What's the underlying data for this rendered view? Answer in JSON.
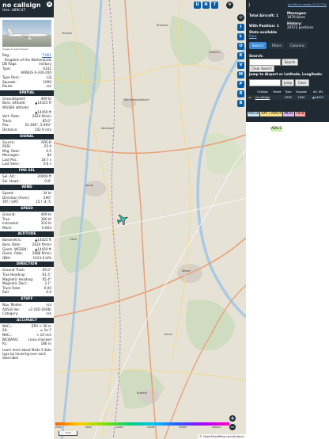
{
  "aircraft": {
    "callsign": "no callsign",
    "hex": "Hex: 489C47",
    "photo_credit": "Image © Gerrit Griem",
    "reg_label": "Reg.:",
    "reg_value": "T-061",
    "country": "Kingdom of the Netherlands",
    "db_flags_label": "DB flags:",
    "db_flags_value": "military",
    "type_label": "Type:",
    "type_value": "A332",
    "type_name": "AIRBUS A-330-200",
    "type_desc_label": "Type Desc.:",
    "type_desc_value": "L2J",
    "squawk_label": "Squawk:",
    "squawk_value": "1000",
    "route_label": "Route:",
    "route_value": "n/a"
  },
  "sections": {
    "spatial": {
      "title": "SPATIAL",
      "rows": [
        {
          "k": "Groundspeed:",
          "v": "409 kt"
        },
        {
          "k": "Baro. altitude:",
          "v": "▲14425 ft"
        },
        {
          "k": "WGS84 altitude:",
          "v": ""
        },
        {
          "k": "",
          "v": "▲14450 ft"
        },
        {
          "k": "Vert. Rate:",
          "v": "2624 ft/min"
        },
        {
          "k": "Track:",
          "v": "65.0°"
        },
        {
          "k": "Pos.:",
          "v": "51.466°, 5.993°"
        },
        {
          "k": "Distance:",
          "v": "102.9 nmi"
        }
      ]
    },
    "signal": {
      "title": "SIGNAL",
      "rows": [
        {
          "k": "Source:",
          "v": "ADS-B"
        },
        {
          "k": "RSSI:",
          "v": "-25.9"
        },
        {
          "k": "Msg. Rate:",
          "v": "0.5"
        },
        {
          "k": "Messages:",
          "v": "84"
        },
        {
          "k": "Last Pos.:",
          "v": "18.7 s"
        },
        {
          "k": "Last Seen:",
          "v": "0.6 s"
        }
      ]
    },
    "fms": {
      "title": "FMS SEL",
      "rows": [
        {
          "k": "Sel. Alt.:",
          "v": "20000 ft"
        },
        {
          "k": "Sel. Head.:",
          "v": "0.8°"
        }
      ]
    },
    "wind": {
      "title": "WIND",
      "rows": [
        {
          "k": "Speed:",
          "v": "34 kt"
        },
        {
          "k": "Direction (from):",
          "v": "290°"
        },
        {
          "k": "TAT / OAT:",
          "v": "15 / -4 °C"
        }
      ]
    },
    "speed": {
      "title": "SPEED",
      "rows": [
        {
          "k": "Ground:",
          "v": "409 kt"
        },
        {
          "k": "True:",
          "v": "386 kt"
        },
        {
          "k": "Indicated:",
          "v": "310 kt"
        },
        {
          "k": "Mach:",
          "v": "0.604"
        }
      ]
    },
    "altitude": {
      "title": "ALTITUDE",
      "rows": [
        {
          "k": "Barometric:",
          "v": "▲14425 ft"
        },
        {
          "k": "Baro. Rate:",
          "v": "2624 ft/min"
        },
        {
          "k": "Geom. WGS84:",
          "v": "▲14450 ft"
        },
        {
          "k": "Geom. Rate:",
          "v": "2688 ft/min"
        },
        {
          "k": "QNH:",
          "v": "1013.6 hPa"
        }
      ]
    },
    "direction": {
      "title": "DIRECTION",
      "rows": [
        {
          "k": "Ground Track:",
          "v": "65.0°"
        },
        {
          "k": "True Heading:",
          "v": "61.5°"
        },
        {
          "k": "Magnetic Heading:",
          "v": "65.4°"
        },
        {
          "k": "Magnetic Decl.:",
          "v": "3.1°"
        },
        {
          "k": "Track Rate:",
          "v": "0.00"
        },
        {
          "k": "Roll:",
          "v": "0.0"
        }
      ]
    },
    "stuff": {
      "title": "STUFF",
      "rows": [
        {
          "k": "Nav. Modes:",
          "v": "n/a"
        },
        {
          "k": "ADS-B Ver.:",
          "v": "v2 (DO-260B)"
        },
        {
          "k": "Category:",
          "v": "n/a"
        }
      ]
    },
    "accuracy": {
      "title": "ACCURACY",
      "rows": [
        {
          "k": "NACₚ:",
          "v": "EPU < 30 m"
        },
        {
          "k": "SIL:",
          "v": "≤ 1e-7"
        },
        {
          "k": "NACᵥ:",
          "v": "< 10 m/s"
        },
        {
          "k": "NICBARO:",
          "v": "cross-checked"
        },
        {
          "k": "Rc:",
          "v": "186 m"
        }
      ]
    },
    "footer": "Learn more about Mode S data type by hovering over each data label"
  },
  "map": {
    "top_buttons": [
      "U",
      "H",
      "T"
    ],
    "vertical_buttons": [
      "I",
      "L",
      "O",
      "K",
      "V",
      "M",
      "P",
      "R",
      "B"
    ],
    "zoom_in": "+",
    "zoom_out": "−",
    "scale": "1 km",
    "altitude_ticks": [
      "2000",
      "6000",
      "10000",
      "20000",
      "30000",
      "40000+"
    ],
    "attribution": "© OpenStreetMap contributors.",
    "places": [
      "Venlo",
      "Wesel",
      "Krefeld",
      "Geldern",
      "Mönchengladbach",
      "Goch",
      "Kleve",
      "Kevelaer",
      "Straelen",
      "Viersen"
    ]
  },
  "sidebar": {
    "collapse": "⟩",
    "header_link": "tar1090 on readsb (3.14.1770)",
    "total_aircraft_label": "Total Aircraft:",
    "total_aircraft_value": "1",
    "with_position_label": "With Position:",
    "with_position_value": "1",
    "messages_label": "Messages:",
    "messages_value": "1879.8/sec",
    "history_label": "History:",
    "history_value": "20572 positions",
    "stats_label": "Stats available",
    "stats_link": "here",
    "tabs": [
      "Search",
      "Filters",
      "Columns"
    ],
    "search_label": "Search:",
    "search_button": "Search",
    "clear_search_button": "Clear Search",
    "jump_label": "Jump to Airport or Latitude, Longitude:",
    "jump_button": "Jump",
    "clear_button": "Clear",
    "columns": [
      "",
      "Callsign",
      "Route",
      "Type",
      "Squawk",
      "Alt. (ft)"
    ],
    "rows": [
      {
        "flag": "▬",
        "callsign": "no callsign",
        "route": "",
        "type": "A332",
        "squawk": "1000",
        "alt": "▲14425"
      }
    ],
    "legend": [
      "ADS-B",
      "UAT / ADS-R",
      "MLAT",
      "TIS-B",
      "Mode-S",
      "AIS",
      "ADS-C"
    ]
  },
  "colors": {
    "dark": "#1f2a33",
    "accent": "#3b8bd8",
    "button_blue": "#0a5ea8",
    "legend_adsb": "#c7e3f7",
    "legend_uat": "#f8de87",
    "legend_mlat": "#d6b8f0",
    "legend_tisb": "#ffa4a4",
    "legend_adsc": "#c9f0b0"
  }
}
